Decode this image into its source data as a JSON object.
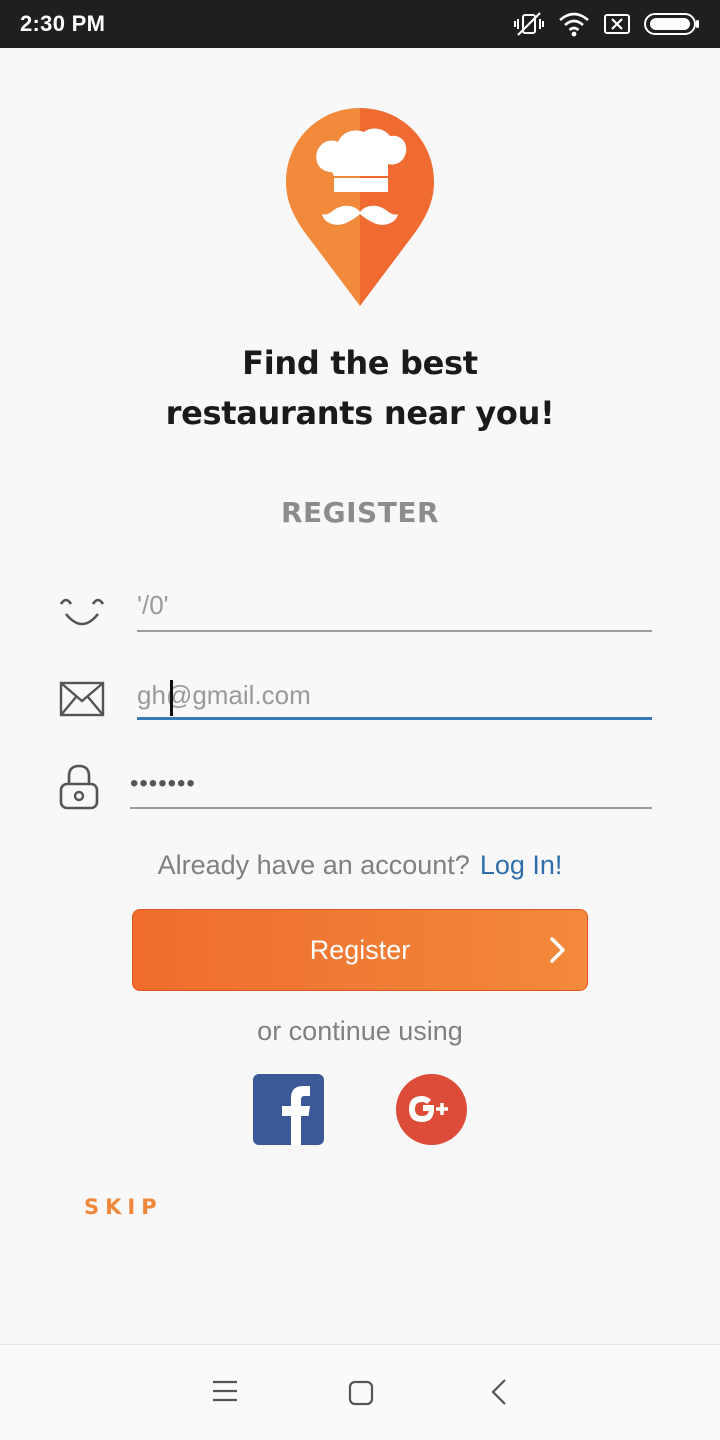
{
  "status_bar": {
    "time": "2:30 PM",
    "icons": [
      "vibrate-off-icon",
      "wifi-icon",
      "no-sim-icon",
      "battery-icon"
    ]
  },
  "app": {
    "headline_line1": "Find the best",
    "headline_line2": "restaurants near you!",
    "section_title": "REGISTER"
  },
  "form": {
    "name": {
      "value": "'/0'",
      "icon": "smiley-icon"
    },
    "email": {
      "value": "gh@gmail.com",
      "icon": "mail-icon",
      "focused": true
    },
    "password": {
      "value": "•••••••",
      "icon": "lock-icon"
    }
  },
  "login_prompt": {
    "text": "Already have an account?",
    "link": "Log In!"
  },
  "register_button": {
    "label": "Register"
  },
  "social": {
    "prompt": "or continue using",
    "facebook": "facebook-icon",
    "google_plus": "google-plus-icon"
  },
  "skip_label": "SKIP",
  "nav": [
    "menu-icon",
    "home-icon",
    "back-icon"
  ],
  "colors": {
    "accent": "#f07a35",
    "link": "#2f6fab",
    "facebook": "#3b5998",
    "google_plus": "#dd4b39",
    "active_field": "#3a7ab8"
  }
}
